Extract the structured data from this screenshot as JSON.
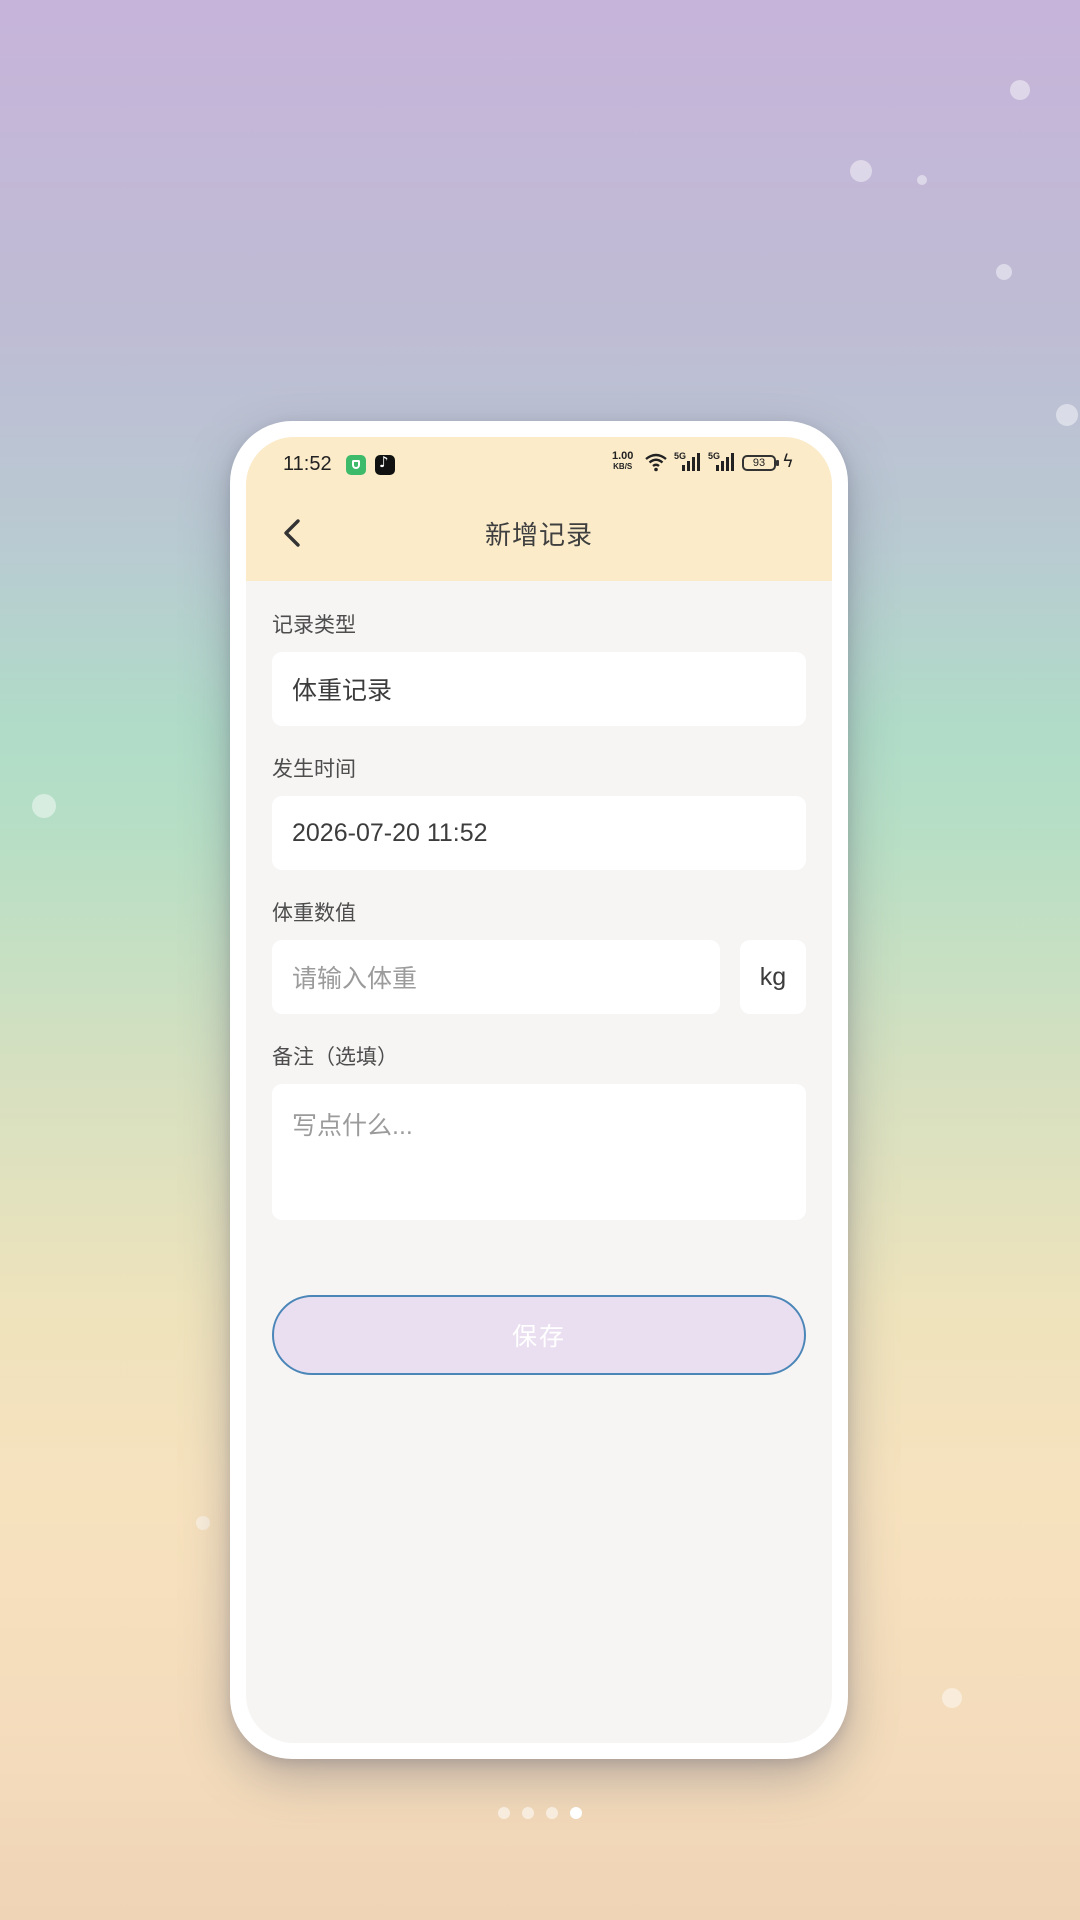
{
  "status_bar": {
    "time": "11:52",
    "network_speed_value": "1.00",
    "network_speed_unit": "KB/S",
    "signal_1_label": "5G",
    "signal_2_label": "5G",
    "battery_level": "93",
    "icons": [
      "shield-app-icon",
      "tiktok-app-icon",
      "wifi-icon",
      "signal-icon",
      "battery-icon",
      "charging-icon"
    ]
  },
  "header": {
    "title": "新增记录"
  },
  "form": {
    "record_type": {
      "label": "记录类型",
      "value": "体重记录"
    },
    "time": {
      "label": "发生时间",
      "value": "2026-07-20 11:52"
    },
    "weight": {
      "label": "体重数值",
      "placeholder": "请输入体重",
      "unit": "kg"
    },
    "note": {
      "label": "备注（选填）",
      "placeholder": "写点什么..."
    }
  },
  "save_button": {
    "label": "保存"
  },
  "pager": {
    "total_pages": 4,
    "active_page": 4
  },
  "colors": {
    "header_bg": "#fbebc9",
    "screen_bg": "#f6f5f4",
    "save_bg": "#eadff0",
    "save_border": "#4b86b8"
  }
}
